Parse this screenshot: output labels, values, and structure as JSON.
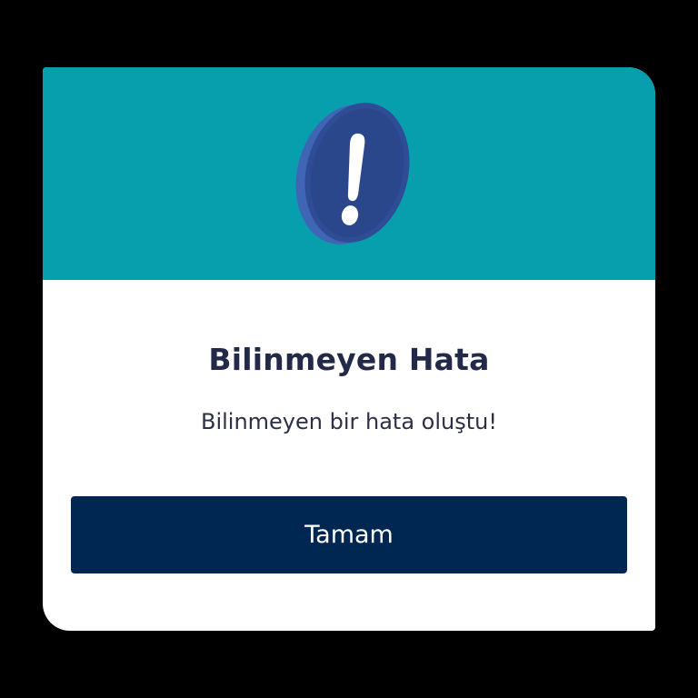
{
  "dialog": {
    "title": "Bilinmeyen Hata",
    "message": "Bilinmeyen bir hata oluştu!",
    "ok_label": "Tamam",
    "icon": "exclamation-coin-icon"
  },
  "colors": {
    "background": "#000000",
    "header": "#079fad",
    "card": "#ffffff",
    "title": "#232a48",
    "button": "#002652",
    "icon_face": "#2f4d96",
    "icon_rim": "#3f66b5"
  }
}
